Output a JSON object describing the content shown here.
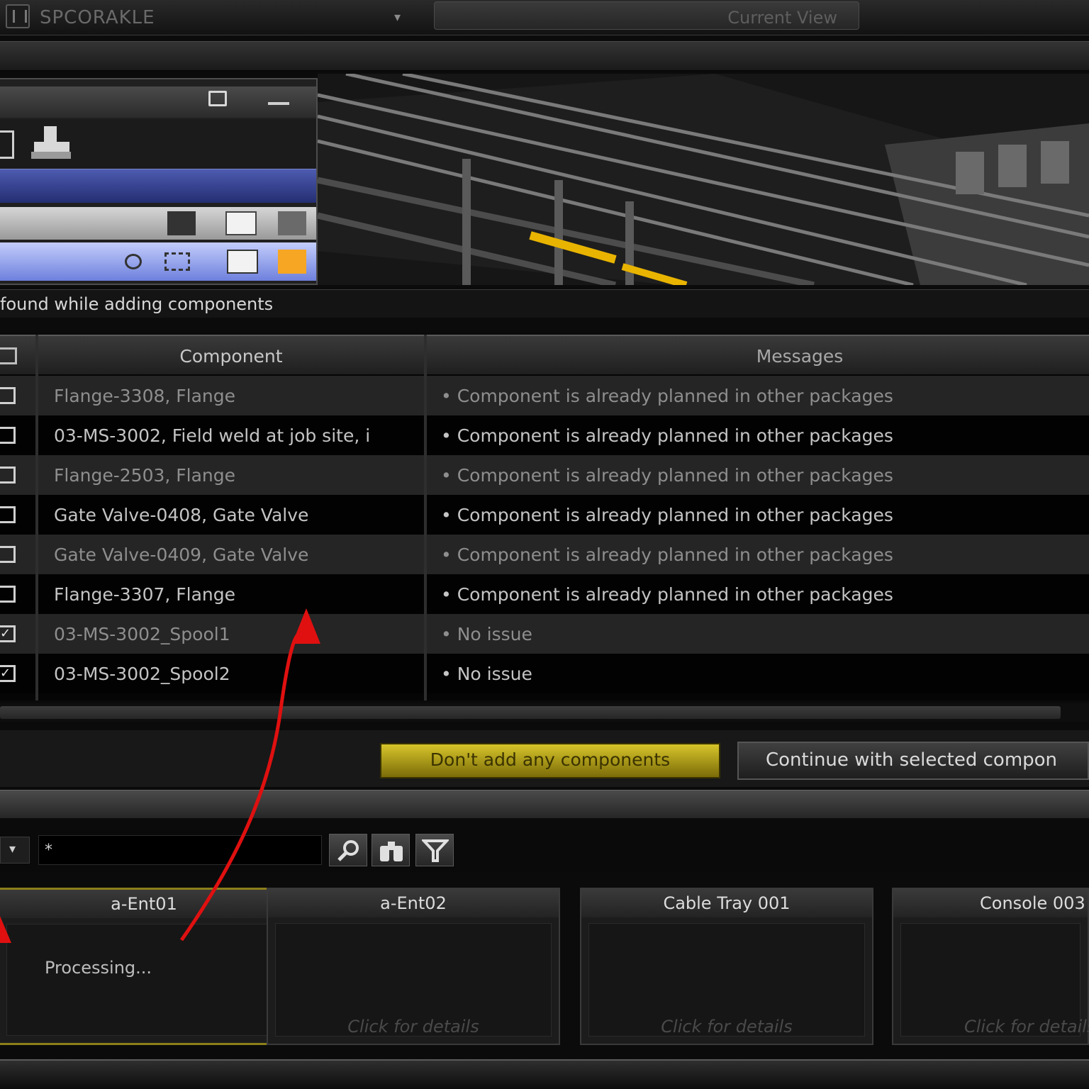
{
  "app": {
    "title": "SPCORAKLE",
    "view_button": "Current View"
  },
  "issues": {
    "banner": "found while adding components"
  },
  "grid": {
    "columns": {
      "component": "Component",
      "messages": "Messages"
    },
    "rows": [
      {
        "component": "Flange-3308, Flange",
        "message": "• Component is already planned in other packages",
        "checked": false
      },
      {
        "component": "03-MS-3002, Field weld at job site, i",
        "message": "• Component is already planned in other packages",
        "checked": false
      },
      {
        "component": "Flange-2503, Flange",
        "message": "• Component is already planned in other packages",
        "checked": false
      },
      {
        "component": "Gate Valve-0408, Gate Valve",
        "message": "• Component is already planned in other packages",
        "checked": false
      },
      {
        "component": "Gate Valve-0409, Gate Valve",
        "message": "• Component is already planned in other packages",
        "checked": false
      },
      {
        "component": "Flange-3307, Flange",
        "message": "• Component is already planned in other packages",
        "checked": false
      },
      {
        "component": "03-MS-3002_Spool1",
        "message": "• No issue",
        "checked": true
      },
      {
        "component": "03-MS-3002_Spool2",
        "message": "• No issue",
        "checked": true
      }
    ]
  },
  "actions": {
    "dont_add": "Don't add any components",
    "continue": "Continue with selected compon"
  },
  "search": {
    "dropdown": "▾",
    "query": "*"
  },
  "cards": [
    {
      "title": "a-Ent01",
      "status": "Processing...",
      "detail": ""
    },
    {
      "title": "a-Ent02",
      "status": "",
      "detail": "Click for details"
    },
    {
      "title": "Cable Tray 001",
      "status": "",
      "detail": "Click for details"
    },
    {
      "title": "Console 003",
      "status": "",
      "detail": "Click for details"
    }
  ],
  "colors": {
    "accent_yellow": "#d7c52a",
    "selection_blue": "#4d5bb0",
    "annotation_red": "#e01010",
    "swatch_orange": "#f6a623"
  },
  "icons": [
    "app-icon",
    "dropdown-arrow-icon",
    "restore-icon",
    "minimize-icon",
    "search-icon",
    "binoculars-icon",
    "filter-icon",
    "arrow-annotation"
  ]
}
